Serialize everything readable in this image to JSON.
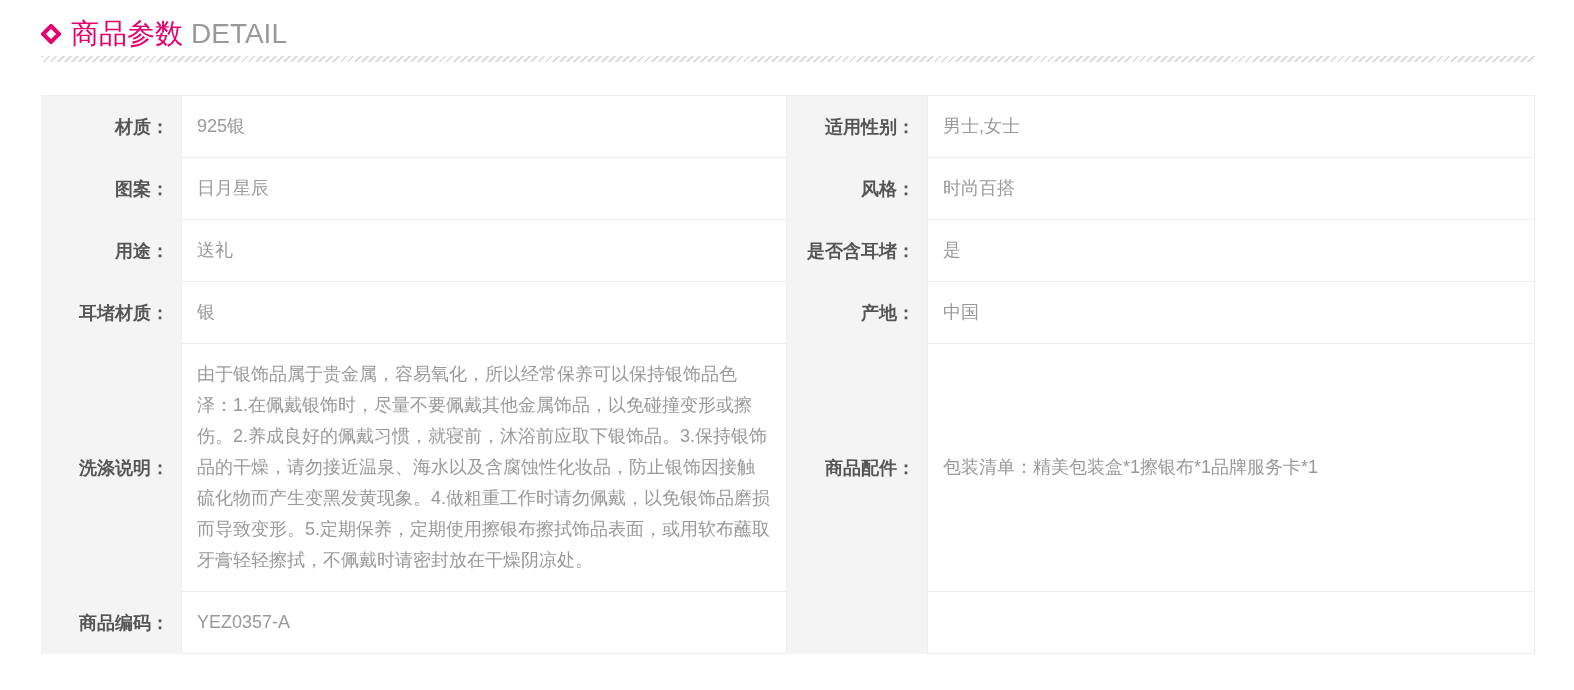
{
  "section": {
    "title": "商品参数",
    "subtitle": "DETAIL"
  },
  "rows": [
    {
      "left": {
        "label": "材质：",
        "value": "925银"
      },
      "right": {
        "label": "适用性别：",
        "value": "男士,女士"
      }
    },
    {
      "left": {
        "label": "图案：",
        "value": "日月星辰"
      },
      "right": {
        "label": "风格：",
        "value": "时尚百搭"
      }
    },
    {
      "left": {
        "label": "用途：",
        "value": "送礼"
      },
      "right": {
        "label": "是否含耳堵：",
        "value": "是"
      }
    },
    {
      "left": {
        "label": "耳堵材质：",
        "value": "银"
      },
      "right": {
        "label": "产地：",
        "value": "中国"
      }
    },
    {
      "left": {
        "label": "洗涤说明：",
        "value": "由于银饰品属于贵金属，容易氧化，所以经常保养可以保持银饰品色泽：1.在佩戴银饰时，尽量不要佩戴其他金属饰品，以免碰撞变形或擦伤。2.养成良好的佩戴习惯，就寝前，沐浴前应取下银饰品。3.保持银饰品的干燥，请勿接近温泉、海水以及含腐蚀性化妆品，防止银饰因接触硫化物而产生变黑发黄现象。4.做粗重工作时请勿佩戴，以免银饰品磨损而导致变形。5.定期保养，定期使用擦银布擦拭饰品表面，或用软布蘸取牙膏轻轻擦拭，不佩戴时请密封放在干燥阴凉处。"
      },
      "right": {
        "label": "商品配件：",
        "value": "包装清单：精美包装盒*1擦银布*1品牌服务卡*1"
      }
    },
    {
      "left": {
        "label": "商品编码：",
        "value": "YEZ0357-A"
      },
      "right": null
    }
  ]
}
